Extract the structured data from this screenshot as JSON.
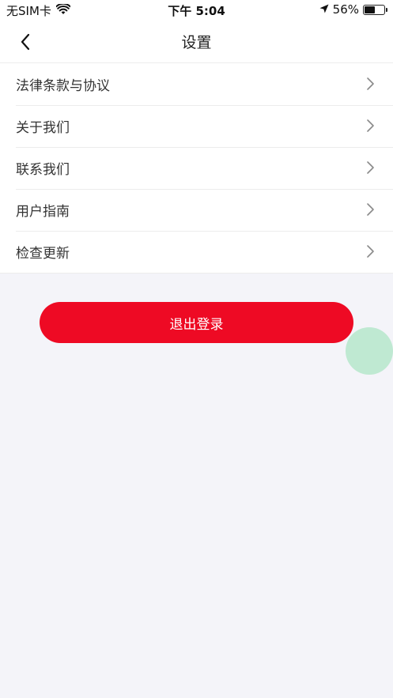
{
  "status_bar": {
    "carrier": "无SIM卡",
    "time": "下午 5:04",
    "battery_percent": "56%",
    "battery_level": 0.56
  },
  "nav": {
    "title": "设置",
    "back_icon": "chevron-left-icon"
  },
  "menu": {
    "items": [
      {
        "label": "法律条款与协议"
      },
      {
        "label": "关于我们"
      },
      {
        "label": "联系我们"
      },
      {
        "label": "用户指南"
      },
      {
        "label": "检查更新"
      }
    ],
    "chevron_icon": "chevron-right-icon"
  },
  "actions": {
    "logout_label": "退出登录"
  },
  "colors": {
    "accent": "#ee0a24",
    "background": "#f4f4f9",
    "assist_dot": "#bfe9d2"
  }
}
